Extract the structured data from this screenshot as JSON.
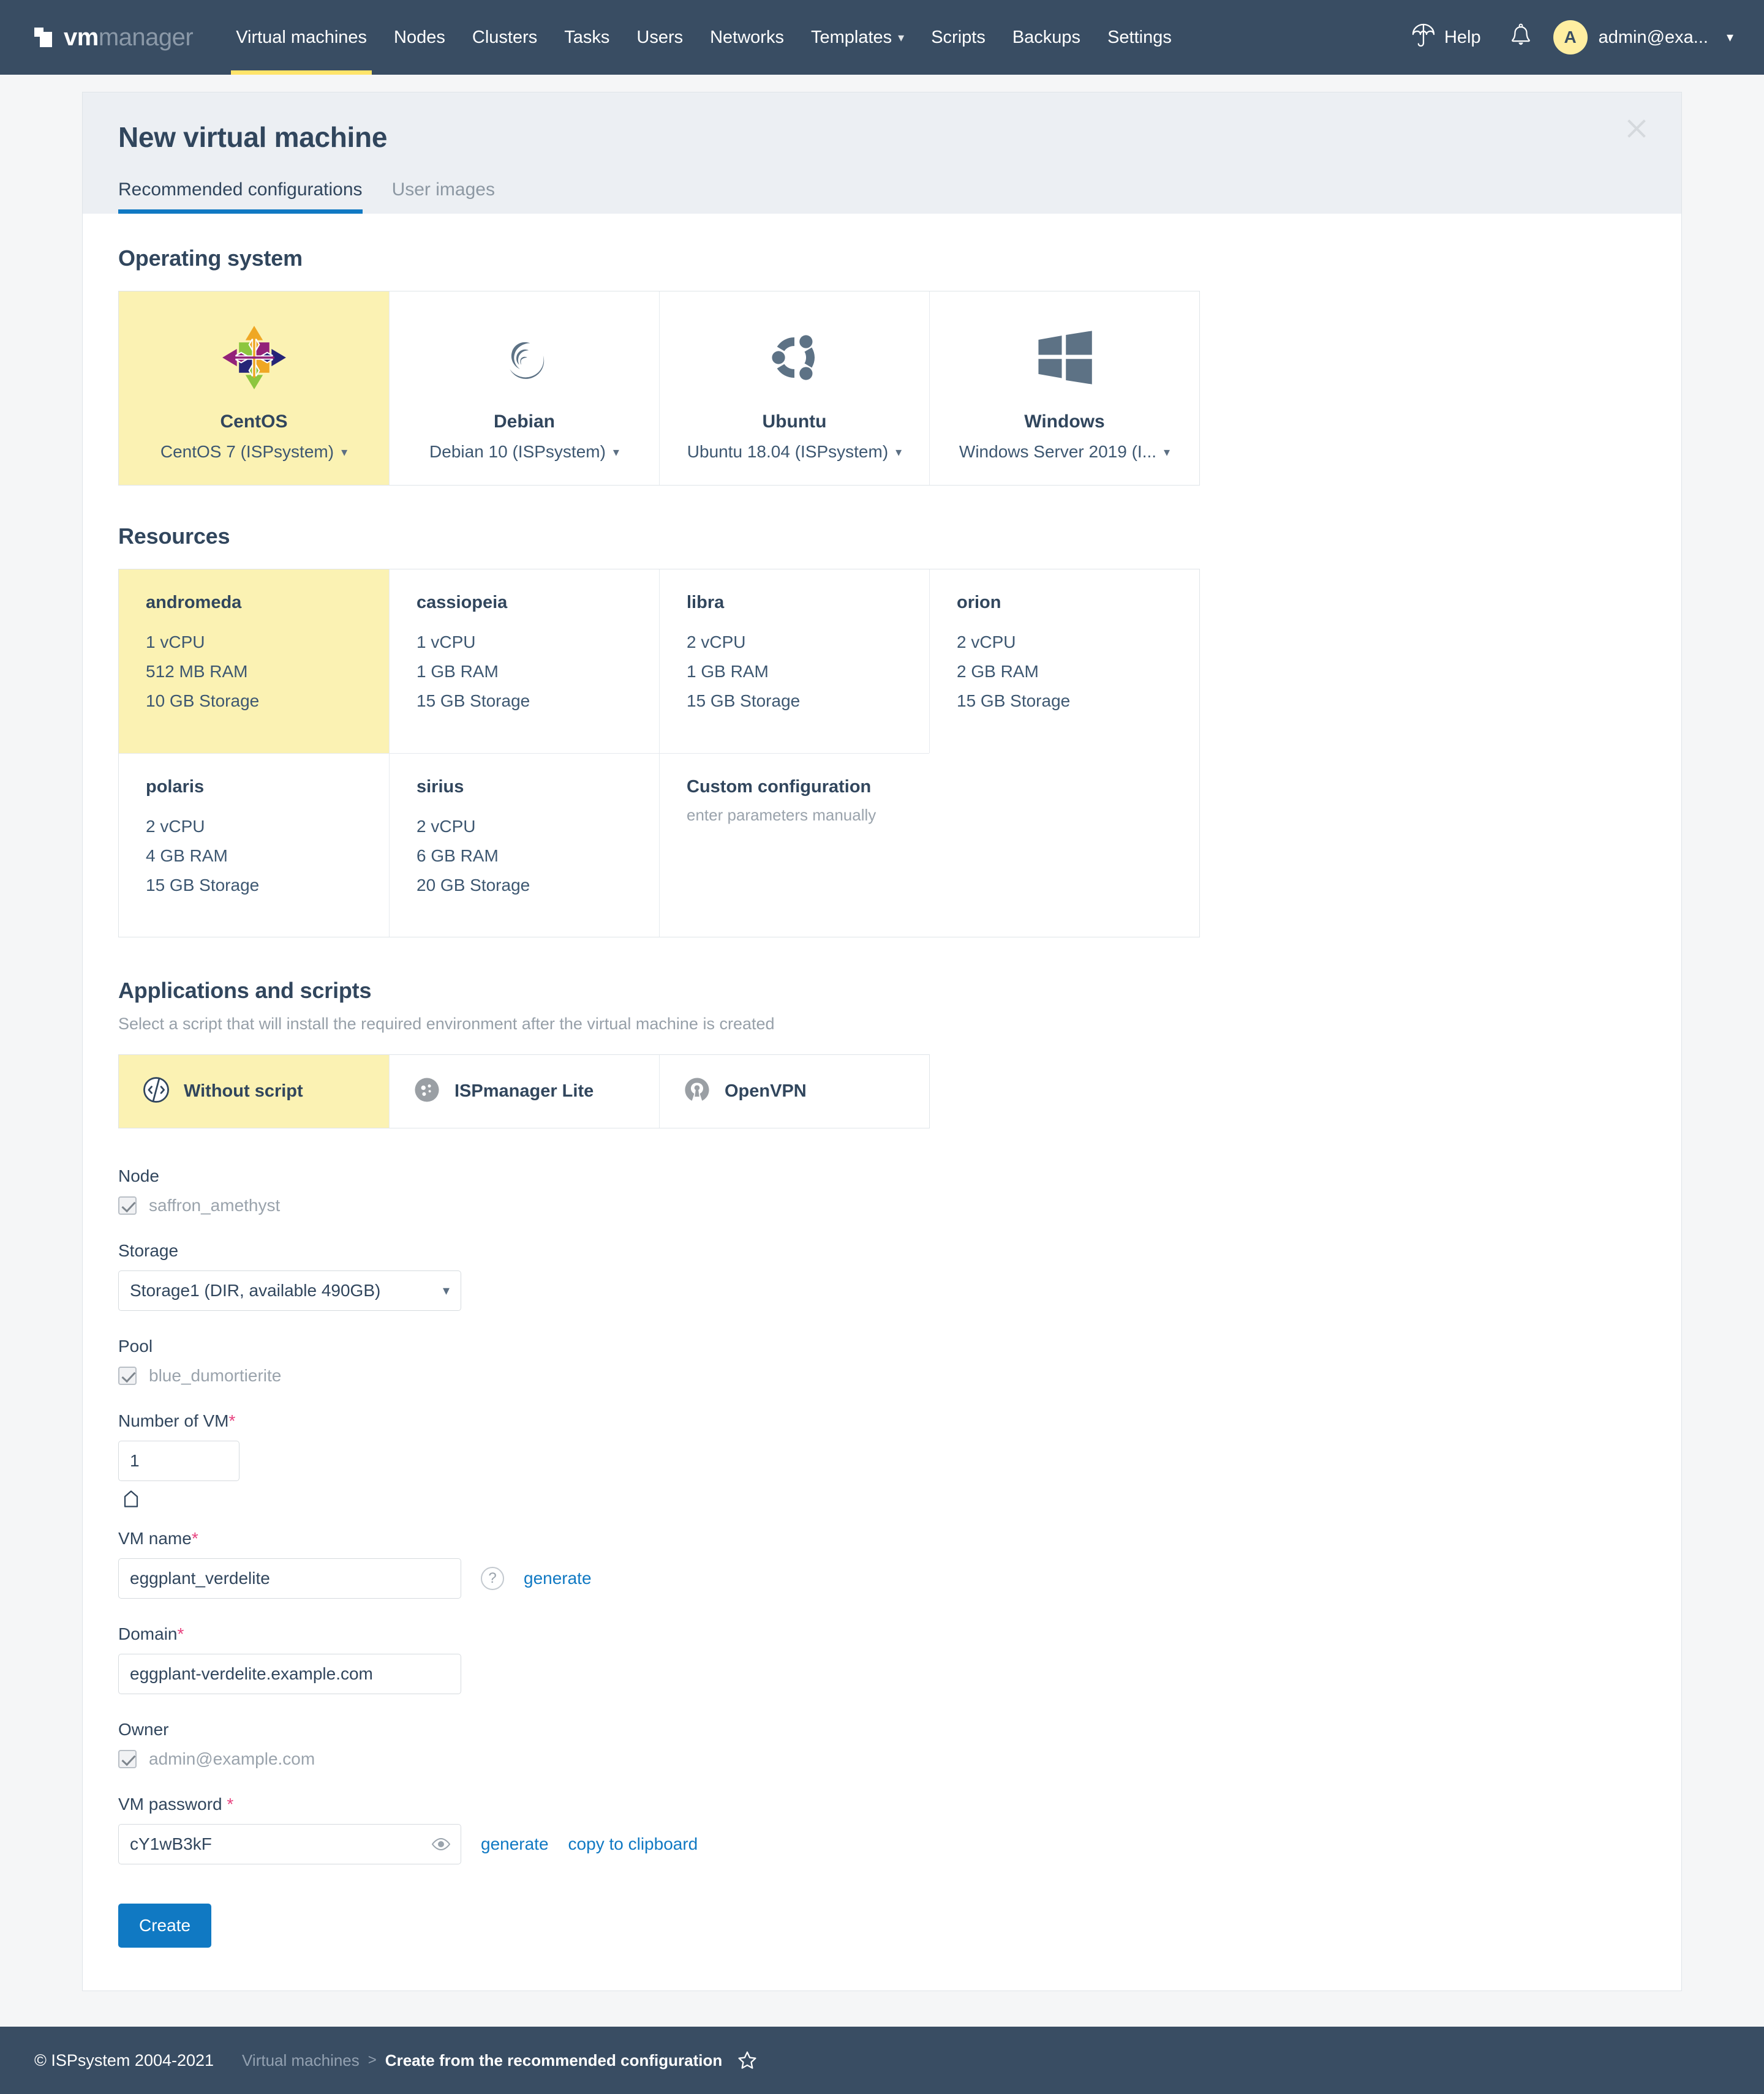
{
  "nav": {
    "brand_vm": "vm",
    "brand_manager": "manager",
    "items": [
      {
        "label": "Virtual machines",
        "active": true,
        "caret": false
      },
      {
        "label": "Nodes",
        "active": false,
        "caret": false
      },
      {
        "label": "Clusters",
        "active": false,
        "caret": false
      },
      {
        "label": "Tasks",
        "active": false,
        "caret": false
      },
      {
        "label": "Users",
        "active": false,
        "caret": false
      },
      {
        "label": "Networks",
        "active": false,
        "caret": false
      },
      {
        "label": "Templates",
        "active": false,
        "caret": true
      },
      {
        "label": "Scripts",
        "active": false,
        "caret": false
      },
      {
        "label": "Backups",
        "active": false,
        "caret": false
      },
      {
        "label": "Settings",
        "active": false,
        "caret": false
      }
    ],
    "help_label": "Help",
    "avatar_letter": "A",
    "username": "admin@exa...",
    "caret_glyph": "⌄"
  },
  "panel": {
    "title": "New virtual machine",
    "tabs": [
      {
        "label": "Recommended configurations",
        "active": true
      },
      {
        "label": "User images",
        "active": false
      }
    ]
  },
  "os_section": {
    "title": "Operating system",
    "cards": [
      {
        "name": "CentOS",
        "version": "CentOS 7 (ISPsystem)",
        "icon": "centos-logo",
        "selected": true
      },
      {
        "name": "Debian",
        "version": "Debian 10 (ISPsystem)",
        "icon": "debian-logo",
        "selected": false
      },
      {
        "name": "Ubuntu",
        "version": "Ubuntu 18.04 (ISPsystem)",
        "icon": "ubuntu-logo",
        "selected": false
      },
      {
        "name": "Windows",
        "version": "Windows Server 2019 (I...",
        "icon": "windows-logo",
        "selected": false
      }
    ]
  },
  "resources_section": {
    "title": "Resources",
    "cards": [
      {
        "name": "andromeda",
        "cpu": "1 vCPU",
        "ram": "512 MB RAM",
        "storage": "10 GB Storage",
        "selected": true
      },
      {
        "name": "cassiopeia",
        "cpu": "1 vCPU",
        "ram": "1 GB RAM",
        "storage": "15 GB Storage",
        "selected": false
      },
      {
        "name": "libra",
        "cpu": "2 vCPU",
        "ram": "1 GB RAM",
        "storage": "15 GB Storage",
        "selected": false
      },
      {
        "name": "orion",
        "cpu": "2 vCPU",
        "ram": "2 GB RAM",
        "storage": "15 GB Storage",
        "selected": false
      },
      {
        "name": "polaris",
        "cpu": "2 vCPU",
        "ram": "4 GB RAM",
        "storage": "15 GB Storage",
        "selected": false
      },
      {
        "name": "sirius",
        "cpu": "2 vCPU",
        "ram": "6 GB RAM",
        "storage": "20 GB Storage",
        "selected": false
      }
    ],
    "custom": {
      "name": "Custom configuration",
      "sub": "enter parameters manually"
    }
  },
  "scripts_section": {
    "title": "Applications and scripts",
    "subtitle": "Select a script that will install the required environment after the virtual machine is created",
    "cards": [
      {
        "label": "Without script",
        "icon": "code-slash-icon",
        "selected": true
      },
      {
        "label": "ISPmanager Lite",
        "icon": "ispmanager-icon",
        "selected": false
      },
      {
        "label": "OpenVPN",
        "icon": "openvpn-icon",
        "selected": false
      }
    ]
  },
  "form": {
    "node": {
      "label": "Node",
      "value": "saffron_amethyst"
    },
    "storage": {
      "label": "Storage",
      "value": "Storage1 (DIR, available 490GB)"
    },
    "pool": {
      "label": "Pool",
      "value": "blue_dumortierite"
    },
    "number_of_vm": {
      "label": "Number of VM",
      "required": "*",
      "value": "1"
    },
    "vm_name": {
      "label": "VM name",
      "required": "*",
      "value": "eggplant_verdelite",
      "help": "?",
      "generate": "generate"
    },
    "domain": {
      "label": "Domain",
      "required": "*",
      "value": "eggplant-verdelite.example.com"
    },
    "owner": {
      "label": "Owner",
      "value": "admin@example.com"
    },
    "vm_password": {
      "label": "VM password",
      "required": "*",
      "value": "cY1wB3kF",
      "generate": "generate",
      "copy": "copy to clipboard"
    },
    "create_button": "Create"
  },
  "footer": {
    "copyright": "© ISPsystem 2004-2021",
    "crumb_parent": "Virtual machines",
    "crumb_sep": ">",
    "crumb_current": "Create from the recommended configuration"
  },
  "colors": {
    "nav_bg": "#394d63",
    "accent_blue": "#1079c3",
    "selected_yellow": "#fbf2b3",
    "tab_yellow": "#ffe46a",
    "required_pink": "#e8427f",
    "text_dark": "#31465d",
    "text_muted": "#9aa3ac"
  }
}
